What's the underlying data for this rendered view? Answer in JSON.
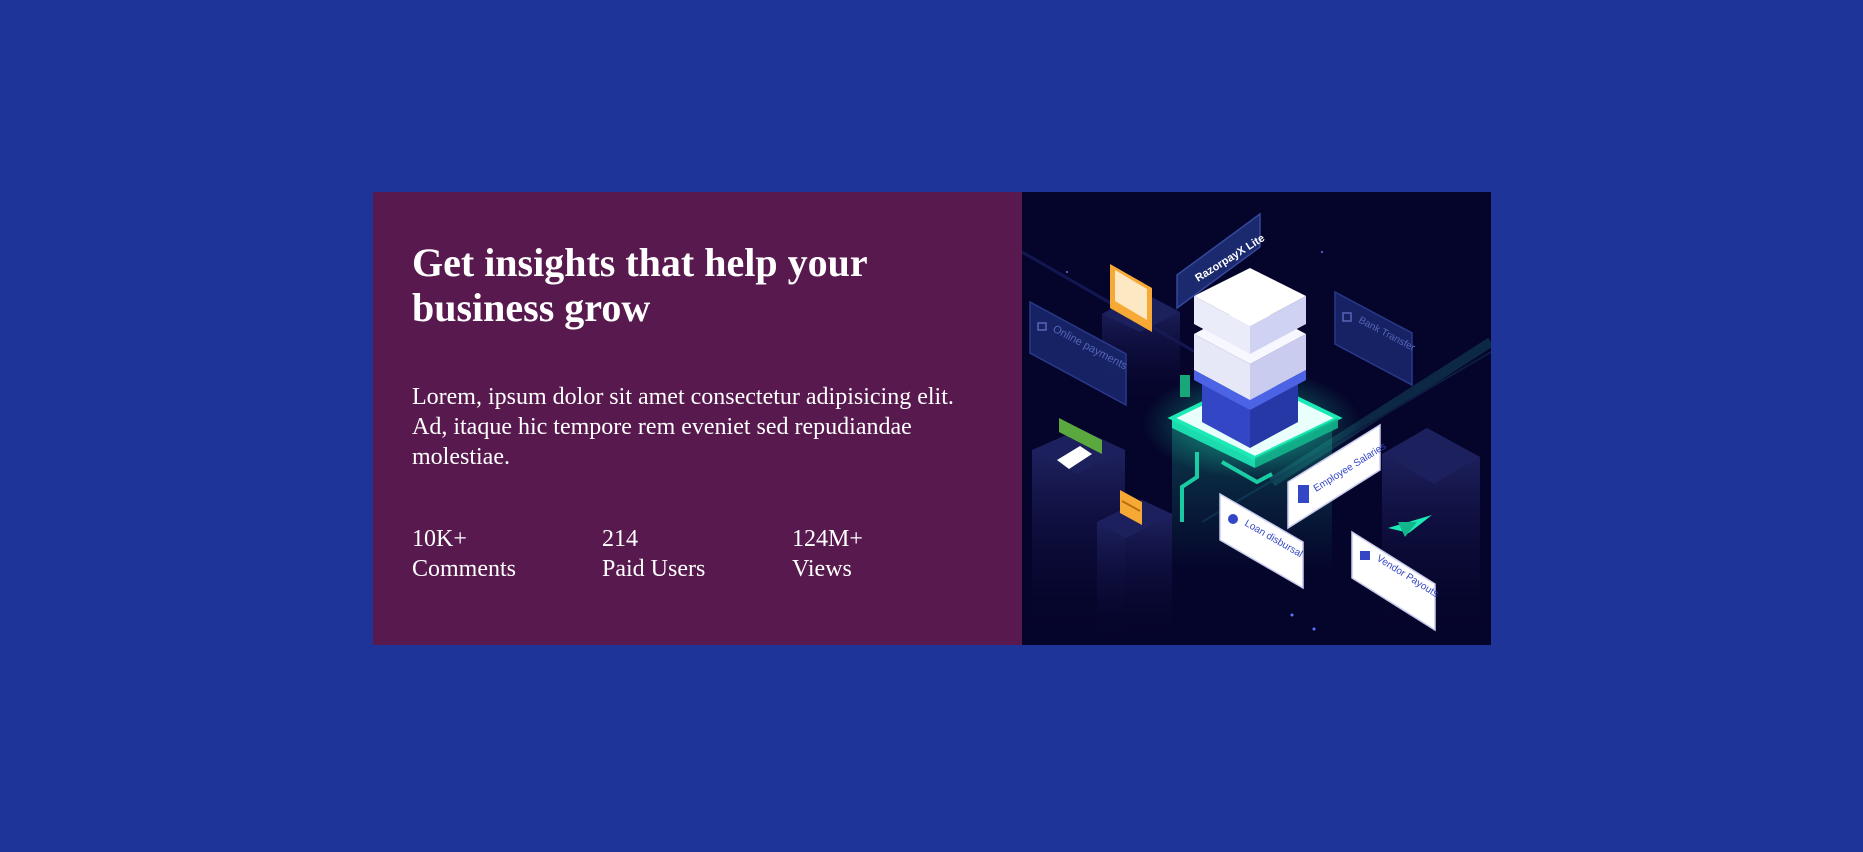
{
  "card": {
    "title": "Get insights that help your business grow",
    "body": "Lorem, ipsum dolor sit amet consectetur adipisicing elit. Ad, itaque hic tempore rem eveniet sed repudiandae molestiae.",
    "stats": [
      {
        "value": "10K+",
        "label": "Comments"
      },
      {
        "value": "214",
        "label": "Paid Users"
      },
      {
        "value": "124M+",
        "label": "Views"
      }
    ]
  },
  "illustration": {
    "brand_label": "RazorpayX Lite",
    "tags": [
      {
        "label": "Online payments"
      },
      {
        "label": "Bank Transfer"
      },
      {
        "label": "Employee Salaries"
      },
      {
        "label": "Loan disbursal"
      },
      {
        "label": "Vendor Payouts"
      }
    ]
  },
  "colors": {
    "page_background": "#1f3498",
    "text_panel": "#581a4e",
    "image_panel": "#05042a",
    "text": "#ffffff",
    "glow": "#1de9b6"
  }
}
